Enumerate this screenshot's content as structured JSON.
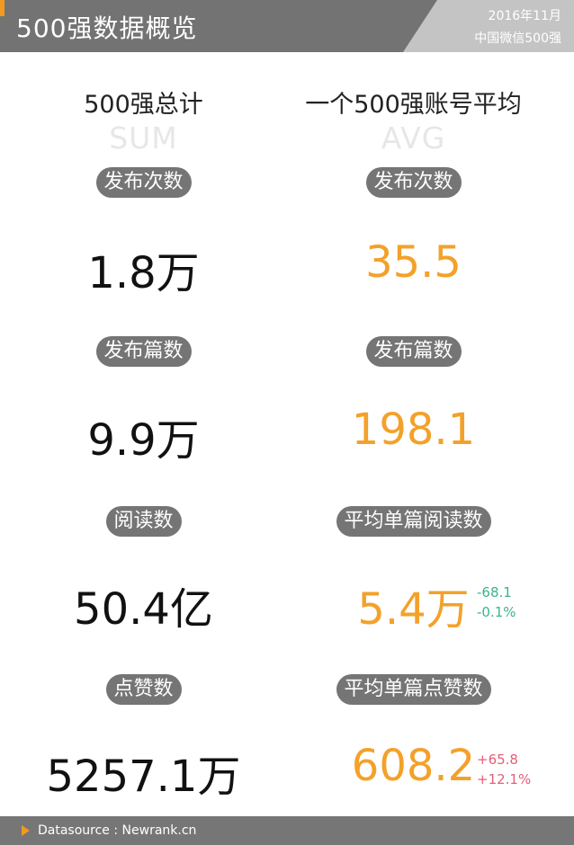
{
  "header": {
    "title": "500强数据概览",
    "date": "2016年11月",
    "subtitle": "中国微信500强"
  },
  "sum": {
    "title": "500强总计",
    "abbr": "SUM",
    "items": [
      {
        "label": "发布次数",
        "value": "1.8万"
      },
      {
        "label": "发布篇数",
        "value": "9.9万"
      },
      {
        "label": "阅读数",
        "value": "50.4亿"
      },
      {
        "label": "点赞数",
        "value": "5257.1万"
      }
    ]
  },
  "avg": {
    "title": "一个500强账号平均",
    "abbr": "AVG",
    "items": [
      {
        "label": "发布次数",
        "value": "35.5"
      },
      {
        "label": "发布篇数",
        "value": "198.1"
      },
      {
        "label": "平均单篇阅读数",
        "value": "5.4万",
        "delta_abs": "-68.1",
        "delta_pct": "-0.1%"
      },
      {
        "label": "平均单篇点赞数",
        "value": "608.2",
        "delta_abs": "+65.8",
        "delta_pct": "+12.1%"
      }
    ]
  },
  "colors": {
    "orange": "#f3a12a",
    "green": "#3cb487",
    "pink": "#e35f77"
  },
  "footer": {
    "text": "Datasource : Newrank.cn"
  }
}
